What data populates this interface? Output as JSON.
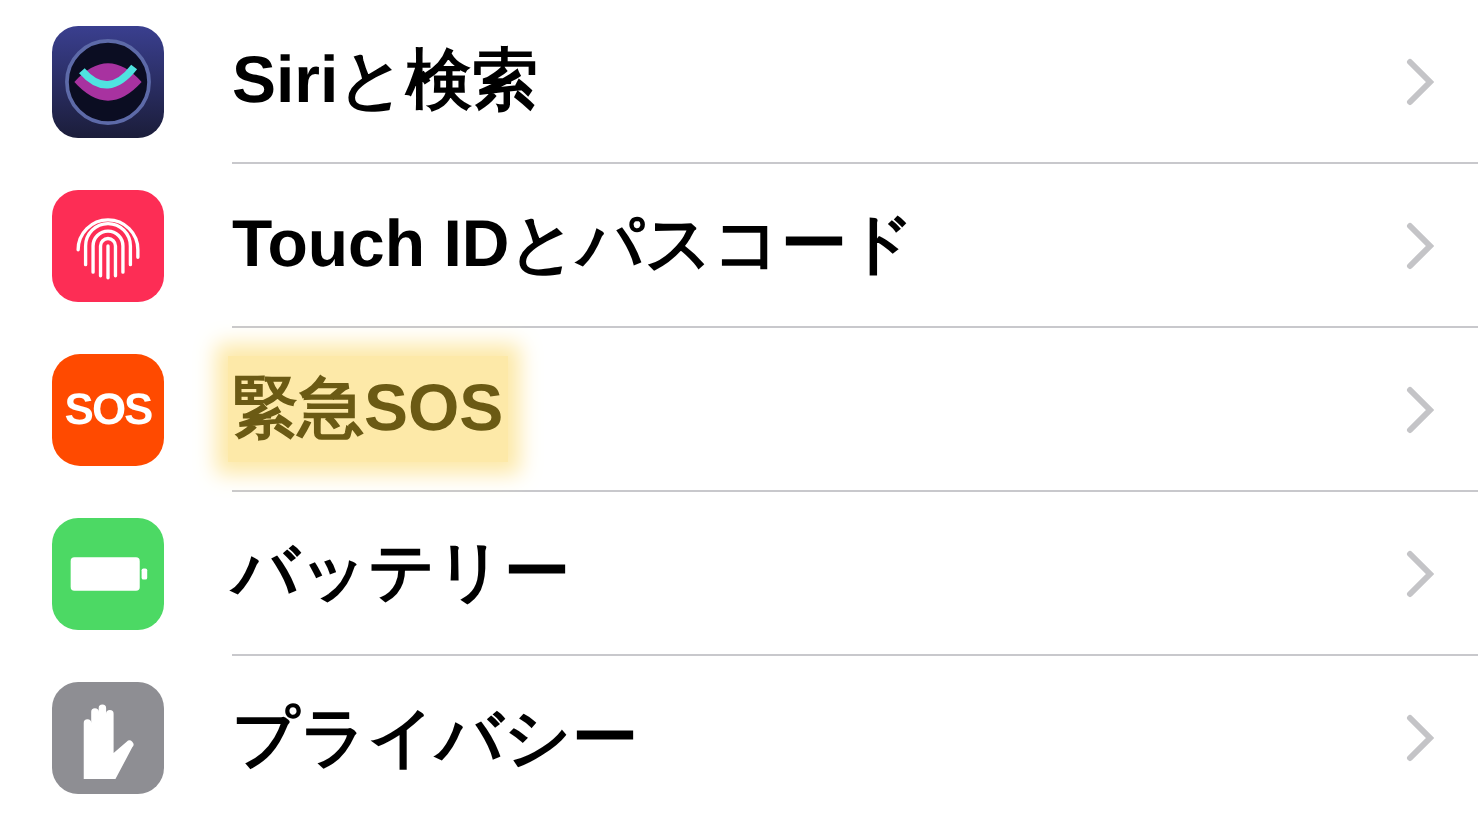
{
  "settings_rows": [
    {
      "kind": "siri",
      "label": "Siriと検索",
      "highlighted": false
    },
    {
      "kind": "touch-id",
      "label": "Touch IDとパスコード",
      "highlighted": false
    },
    {
      "kind": "sos",
      "icon_text": "SOS",
      "label": "緊急SOS",
      "highlighted": true
    },
    {
      "kind": "battery",
      "label": "バッテリー",
      "highlighted": false
    },
    {
      "kind": "privacy",
      "label": "プライバシー",
      "highlighted": false
    }
  ]
}
